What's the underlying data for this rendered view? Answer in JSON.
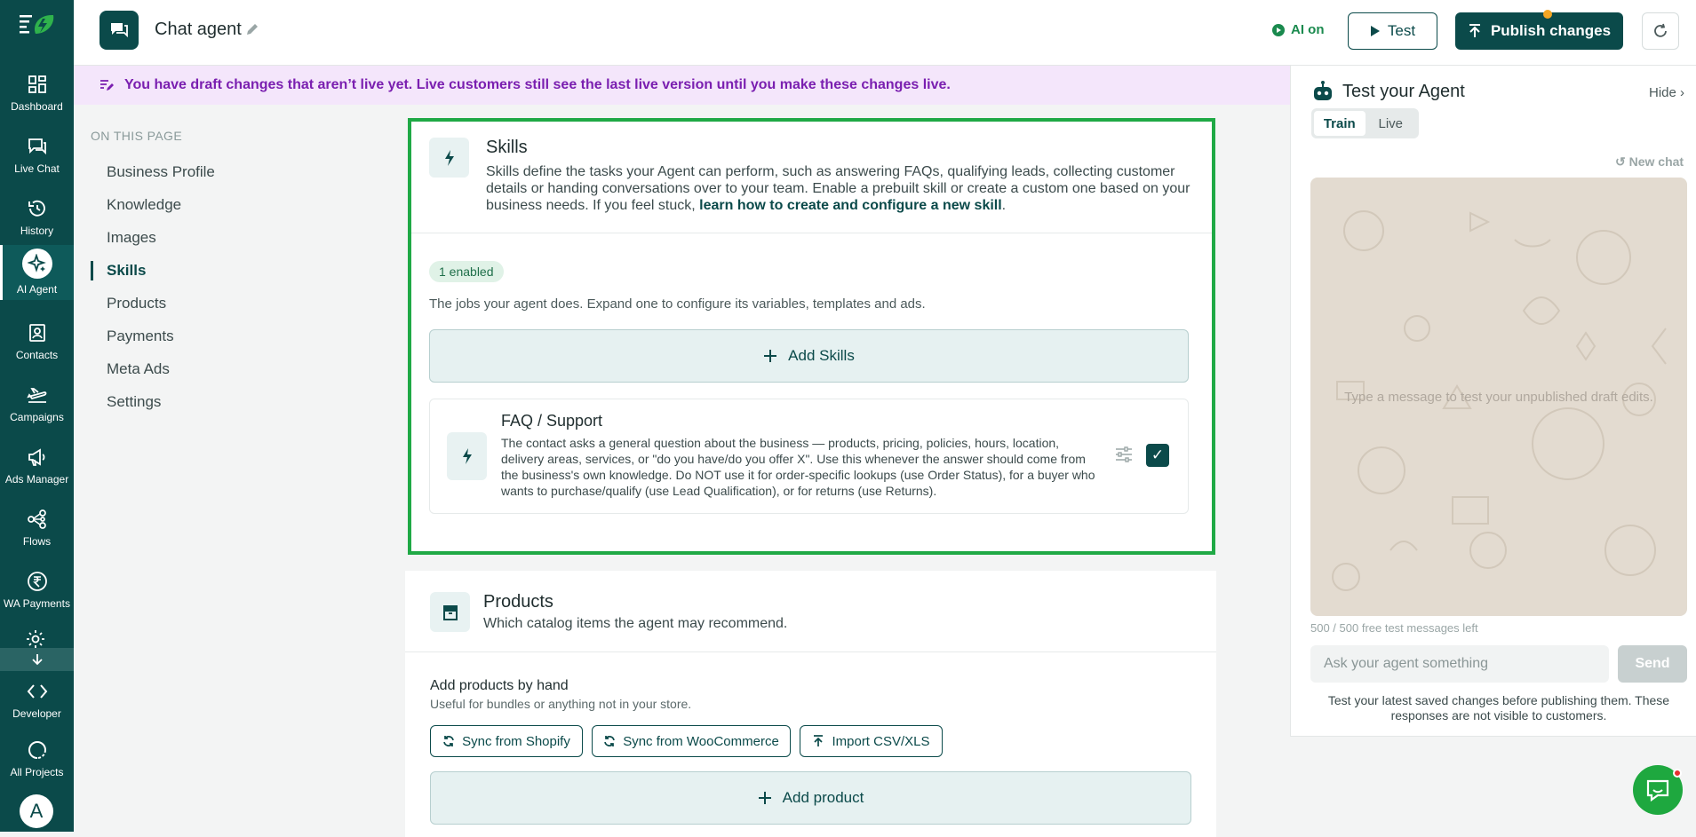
{
  "app": {
    "title": "Chat agent",
    "ai_status": "AI on",
    "test_label": "Test",
    "publish_label": "Publish changes"
  },
  "nav": {
    "items": [
      {
        "label": "Dashboard",
        "icon": "dashboard-icon"
      },
      {
        "label": "Live Chat",
        "icon": "chat-icon"
      },
      {
        "label": "History",
        "icon": "history-icon"
      },
      {
        "label": "AI Agent",
        "icon": "ai-sparkle-icon",
        "active": true
      },
      {
        "label": "Contacts",
        "icon": "contacts-icon"
      },
      {
        "label": "Campaigns",
        "icon": "plane-icon"
      },
      {
        "label": "Ads Manager",
        "icon": "megaphone-icon"
      },
      {
        "label": "Flows",
        "icon": "flows-icon"
      },
      {
        "label": "WA Payments",
        "icon": "rupee-icon"
      },
      {
        "label": "Developer",
        "icon": "code-icon"
      },
      {
        "label": "All Projects",
        "icon": "projects-icon"
      }
    ],
    "avatar_initial": "A"
  },
  "banner": {
    "text": "You have draft changes that aren’t live yet. Live customers still see the last live version until you make these changes live."
  },
  "toc": {
    "heading": "ON THIS PAGE",
    "items": [
      "Business Profile",
      "Knowledge",
      "Images",
      "Skills",
      "Products",
      "Payments",
      "Meta Ads",
      "Settings"
    ],
    "active": "Skills"
  },
  "skills": {
    "title": "Skills",
    "desc_prefix": "Skills define the tasks your Agent can perform, such as answering FAQs, qualifying leads, collecting customer details or handing conversations over to your team. Enable a prebuilt skill or create a custom one based on your business needs. If you feel stuck, ",
    "desc_link": "learn how to create and configure a new skill",
    "desc_suffix": ".",
    "enabled_badge": "1 enabled",
    "subtitle": "The jobs your agent does. Expand one to configure its variables, templates and ads.",
    "add_label": "Add Skills",
    "list": [
      {
        "name": "FAQ / Support",
        "description": "The contact asks a general question about the business — products, pricing, policies, hours, location, delivery areas, services, or \"do you have/do you offer X\". Use this whenever the answer should come from the business's own knowledge. Do NOT use it for order-specific lookups (use Order Status), for a buyer who wants to purchase/qualify (use Lead Qualification), or for returns (use Returns).",
        "enabled": true
      }
    ]
  },
  "products": {
    "title": "Products",
    "desc": "Which catalog items the agent may recommend.",
    "by_hand_title": "Add products by hand",
    "by_hand_desc": "Useful for bundles or anything not in your store.",
    "sync_shopify": "Sync from Shopify",
    "sync_woo": "Sync from WooCommerce",
    "import_csv": "Import CSV/XLS",
    "add_product": "Add product"
  },
  "test_panel": {
    "title": "Test your Agent",
    "hide_label": "Hide ›",
    "tabs": [
      "Train",
      "Live"
    ],
    "active_tab": "Train",
    "new_chat": "↺ New chat",
    "placeholder": "Type a message to test your unpublished draft edits.",
    "quota": "500 / 500 free test messages left",
    "input_placeholder": "Ask your agent something",
    "send_label": "Send",
    "footer": "Test your latest saved changes before publishing them. These responses are not visible to customers."
  },
  "colors": {
    "brand": "#0b4a4a",
    "highlight_border": "#1fa945",
    "banner_bg": "#f4e6fb",
    "banner_text": "#7a1fb0",
    "fab": "#1ea83f"
  }
}
